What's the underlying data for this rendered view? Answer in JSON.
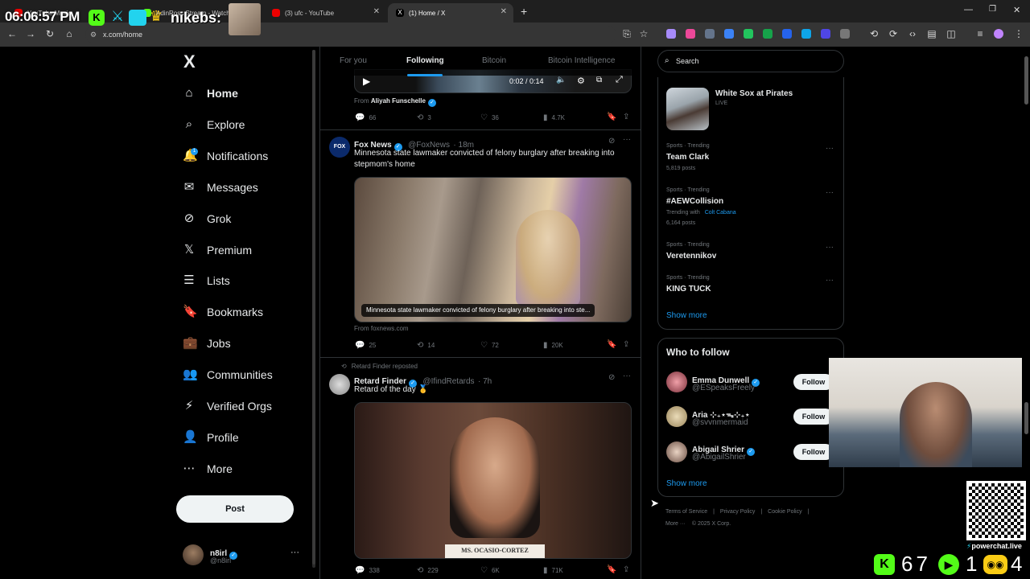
{
  "overlay": {
    "clock": "06:06:57 PM",
    "nikebs": "nikebs:",
    "counters": {
      "k": "67",
      "play": "1",
      "chat": "4"
    },
    "powerchat": "powerchat.live"
  },
  "browser": {
    "tabs": [
      {
        "label": "YouTube Music",
        "active": false
      },
      {
        "label": "AdinRoss Stream - Watch Li",
        "active": false
      },
      {
        "label": "(3) ufc - YouTube",
        "active": false
      },
      {
        "label": "(1) Home / X",
        "active": true
      }
    ],
    "new_tab": "+",
    "url": "x.com/home"
  },
  "sidebar": {
    "logo": "X",
    "items": [
      {
        "label": "Home",
        "icon": "home-icon",
        "glyph": "⌂",
        "active": true
      },
      {
        "label": "Explore",
        "icon": "search-icon",
        "glyph": "⌕",
        "active": false
      },
      {
        "label": "Notifications",
        "icon": "bell-icon",
        "glyph": "🔔",
        "active": false
      },
      {
        "label": "Messages",
        "icon": "mail-icon",
        "glyph": "✉",
        "active": false
      },
      {
        "label": "Grok",
        "icon": "grok-icon",
        "glyph": "⊘",
        "active": false
      },
      {
        "label": "Premium",
        "icon": "x-logo-icon",
        "glyph": "𝕏",
        "active": false
      },
      {
        "label": "Lists",
        "icon": "list-icon",
        "glyph": "☰",
        "active": false
      },
      {
        "label": "Bookmarks",
        "icon": "bookmark-icon",
        "glyph": "🔖",
        "active": false
      },
      {
        "label": "Jobs",
        "icon": "briefcase-icon",
        "glyph": "💼",
        "active": false
      },
      {
        "label": "Communities",
        "icon": "people-icon",
        "glyph": "👥",
        "active": false
      },
      {
        "label": "Verified Orgs",
        "icon": "lightning-icon",
        "glyph": "⚡",
        "active": false
      },
      {
        "label": "Profile",
        "icon": "person-icon",
        "glyph": "👤",
        "active": false
      },
      {
        "label": "More",
        "icon": "more-circle-icon",
        "glyph": "⋯",
        "active": false
      }
    ],
    "notification_badge": "1",
    "post_label": "Post",
    "account": {
      "name": "n8irl",
      "handle": "@n8irl",
      "more": "···"
    }
  },
  "timeline": {
    "tabs": [
      "For you",
      "Following",
      "Bitcoin",
      "Bitcoin Intelligence"
    ],
    "active_tab": 1,
    "post0": {
      "video_time": "0:02 / 0:14",
      "from_label": "From",
      "from_name": "Aliyah Funschelle",
      "metrics": {
        "replies": "66",
        "reposts": "3",
        "likes": "36",
        "views": "4.7K"
      }
    },
    "post1": {
      "name": "Fox News",
      "handle": "@FoxNews",
      "time": "· 18m",
      "text": "Minnesota state lawmaker convicted of felony burglary after breaking into stepmom's home",
      "card_caption": "Minnesota state lawmaker convicted of felony burglary after breaking into ste...",
      "source": "From foxnews.com",
      "metrics": {
        "replies": "25",
        "reposts": "14",
        "likes": "72",
        "views": "20K"
      }
    },
    "post2": {
      "repost_label": "Retard Finder reposted",
      "name": "Retard Finder",
      "handle": "@IfindRetards",
      "time": "· 7h",
      "text": "Retard of the day 🥇",
      "placard": "MS. OCASIO-CORTEZ",
      "metrics": {
        "replies": "338",
        "reposts": "229",
        "likes": "6K",
        "views": "71K"
      }
    }
  },
  "right": {
    "search_placeholder": "Search",
    "live": {
      "title": "White Sox at Pirates",
      "status": "LIVE"
    },
    "trends": [
      {
        "meta": "Sports · Trending",
        "title": "Team Clark",
        "sub": "5,819 posts"
      },
      {
        "meta": "Sports · Trending",
        "title": "#AEWCollision",
        "sub_prefix": "Trending with",
        "sub_link": "Colt Cabana",
        "sub": "6,164 posts"
      },
      {
        "meta": "Sports · Trending",
        "title": "Veretennikov"
      },
      {
        "meta": "Sports · Trending",
        "title": "KING TUCK"
      }
    ],
    "show_more": "Show more",
    "who_to_follow": {
      "heading": "Who to follow",
      "users": [
        {
          "name": "Emma Dunwell",
          "handle": "@ESpeaksFreely",
          "button": "Follow"
        },
        {
          "name": "Aria ⊹₊⋆ᯓ⊹₊⋆",
          "handle": "@svvnmermaid",
          "button": "Follow"
        },
        {
          "name": "Abigail Shrier",
          "handle": "@AbigailShrier",
          "button": "Follow"
        }
      ],
      "show_more": "Show more"
    },
    "footer": {
      "links": [
        "Terms of Service",
        "Privacy Policy",
        "Cookie Policy"
      ],
      "more": "More ···",
      "copyright": "© 2025 X Corp."
    }
  },
  "colors": {
    "accent": "#1d9bf0",
    "bg": "#000000",
    "border": "#2f3336",
    "muted": "#71767b"
  }
}
